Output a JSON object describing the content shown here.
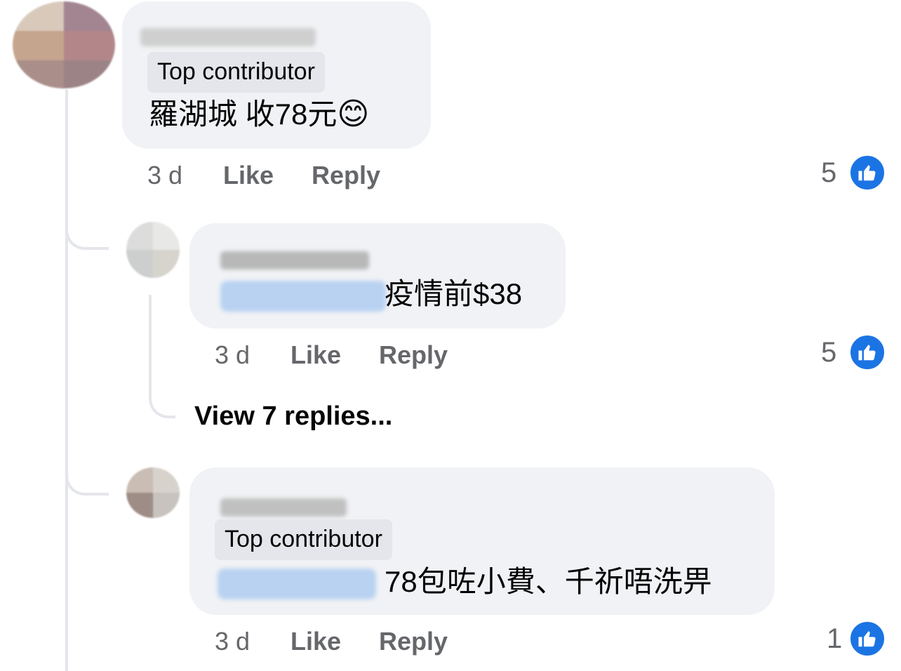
{
  "comments": [
    {
      "badge": "Top contributor",
      "text": "羅湖城 收78元",
      "emoji": "😊",
      "time": "3 d",
      "like_label": "Like",
      "reply_label": "Reply",
      "reaction_count": "5"
    },
    {
      "text": "疫情前$38",
      "time": "3 d",
      "like_label": "Like",
      "reply_label": "Reply",
      "reaction_count": "5"
    },
    {
      "badge": "Top contributor",
      "text": "78包咗小費、千祈唔洗畀",
      "time": "3 d",
      "like_label": "Like",
      "reply_label": "Reply",
      "reaction_count": "1"
    }
  ],
  "view_replies": "View 7 replies...",
  "colors": {
    "like_blue": "#1b74e4",
    "bubble": "#f0f2f5",
    "meta_gray": "#65676b"
  },
  "icons": {
    "reaction": "thumbs-up-icon"
  }
}
